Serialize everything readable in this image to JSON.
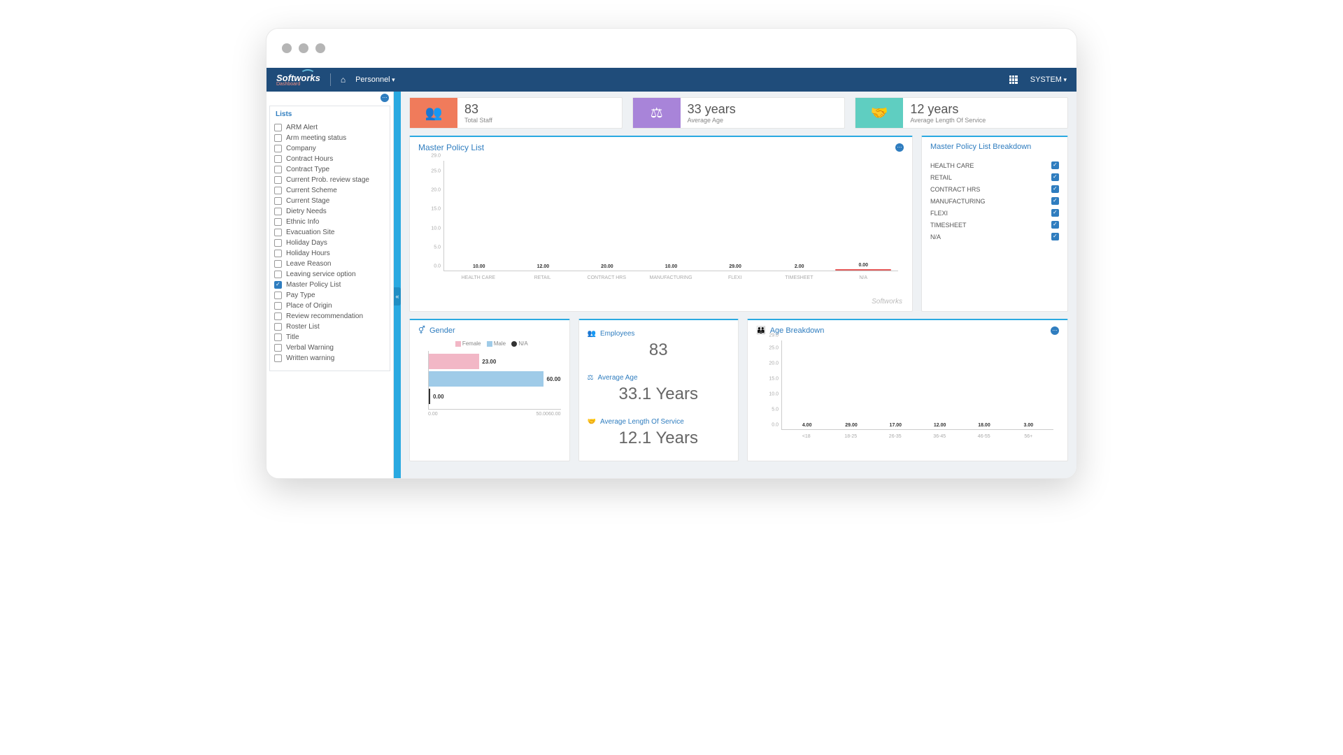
{
  "app": {
    "brand": "Softworks",
    "brand_sub": "Dashboard"
  },
  "nav": {
    "personnel": "Personnel",
    "system": "SYSTEM"
  },
  "sidebar": {
    "header": "Lists",
    "items": [
      {
        "label": "ARM Alert",
        "checked": false
      },
      {
        "label": "Arm meeting status",
        "checked": false
      },
      {
        "label": "Company",
        "checked": false
      },
      {
        "label": "Contract Hours",
        "checked": false
      },
      {
        "label": "Contract Type",
        "checked": false
      },
      {
        "label": "Current Prob. review stage",
        "checked": false
      },
      {
        "label": "Current Scheme",
        "checked": false
      },
      {
        "label": "Current Stage",
        "checked": false
      },
      {
        "label": "Dietry Needs",
        "checked": false
      },
      {
        "label": "Ethnic Info",
        "checked": false
      },
      {
        "label": "Evacuation Site",
        "checked": false
      },
      {
        "label": "Holiday Days",
        "checked": false
      },
      {
        "label": "Holiday Hours",
        "checked": false
      },
      {
        "label": "Leave Reason",
        "checked": false
      },
      {
        "label": "Leaving service option",
        "checked": false
      },
      {
        "label": "Master Policy List",
        "checked": true
      },
      {
        "label": "Pay Type",
        "checked": false
      },
      {
        "label": "Place of Origin",
        "checked": false
      },
      {
        "label": "Review recommendation",
        "checked": false
      },
      {
        "label": "Roster List",
        "checked": false
      },
      {
        "label": "Title",
        "checked": false
      },
      {
        "label": "Verbal Warning",
        "checked": false
      },
      {
        "label": "Written warning",
        "checked": false
      }
    ]
  },
  "stats": [
    {
      "value": "83",
      "label": "Total Staff",
      "color": "#f07b5b",
      "icon": "people"
    },
    {
      "value": "33 years",
      "label": "Average Age",
      "color": "#a884d9",
      "icon": "scale"
    },
    {
      "value": "12 years",
      "label": "Average Length Of Service",
      "color": "#5fcec1",
      "icon": "handshake"
    }
  ],
  "mpl": {
    "title": "Master Policy List",
    "watermark": "Softworks"
  },
  "breakdown": {
    "title": "Master Policy List Breakdown",
    "items": [
      {
        "label": "HEALTH CARE",
        "checked": true
      },
      {
        "label": "RETAIL",
        "checked": true
      },
      {
        "label": "CONTRACT HRS",
        "checked": true
      },
      {
        "label": "MANUFACTURING",
        "checked": true
      },
      {
        "label": "FLEXI",
        "checked": true
      },
      {
        "label": "TIMESHEET",
        "checked": true
      },
      {
        "label": "N/A",
        "checked": true
      }
    ]
  },
  "gender": {
    "title": "Gender",
    "legend": {
      "female": "Female",
      "male": "Male",
      "na": "N/A"
    },
    "xaxis": {
      "a": "0.00",
      "b": "50.00",
      "c": "60.00"
    }
  },
  "metrics": {
    "employees_lbl": "Employees",
    "employees_val": "83",
    "avgage_lbl": "Average Age",
    "avgage_val": "33.1 Years",
    "los_lbl": "Average Length Of Service",
    "los_val": "12.1 Years"
  },
  "age": {
    "title": "Age Breakdown"
  },
  "chart_data": [
    {
      "id": "master_policy_list",
      "type": "bar",
      "categories": [
        "HEALTH CARE",
        "RETAIL",
        "CONTRACT HRS",
        "MANUFACTURING",
        "FLEXI",
        "TIMESHEET",
        "N/A"
      ],
      "values": [
        10.0,
        12.0,
        20.0,
        10.0,
        29.0,
        2.0,
        0.0
      ],
      "colors": [
        "#4f8fc6",
        "#a8c7e8",
        "#f2983a",
        "#f7c899",
        "#57b956",
        "#aadfa9",
        "#e55b5b"
      ],
      "ylim": [
        0,
        29
      ],
      "yticks": [
        0.0,
        5.0,
        10.0,
        15.0,
        20.0,
        25.0,
        29.0
      ]
    },
    {
      "id": "gender",
      "type": "bar-horizontal",
      "categories": [
        "Female",
        "Male",
        "N/A"
      ],
      "values": [
        23.0,
        60.0,
        0.0
      ],
      "colors": [
        "#f2b7c6",
        "#9fcbe8",
        "#333333"
      ],
      "xlim": [
        0,
        60
      ]
    },
    {
      "id": "age_breakdown",
      "type": "bar",
      "categories": [
        "<18",
        "18-25",
        "26-35",
        "36-45",
        "46-55",
        "56+"
      ],
      "values": [
        4.0,
        29.0,
        17.0,
        12.0,
        18.0,
        3.0
      ],
      "colors": [
        "#4f8fc6",
        "#a8c7e8",
        "#f2983a",
        "#f7c899",
        "#57b956",
        "#aadfa9"
      ],
      "ylim": [
        0,
        29
      ],
      "yticks": [
        0.0,
        5.0,
        10.0,
        15.0,
        20.0,
        25.0,
        29.0
      ]
    }
  ]
}
